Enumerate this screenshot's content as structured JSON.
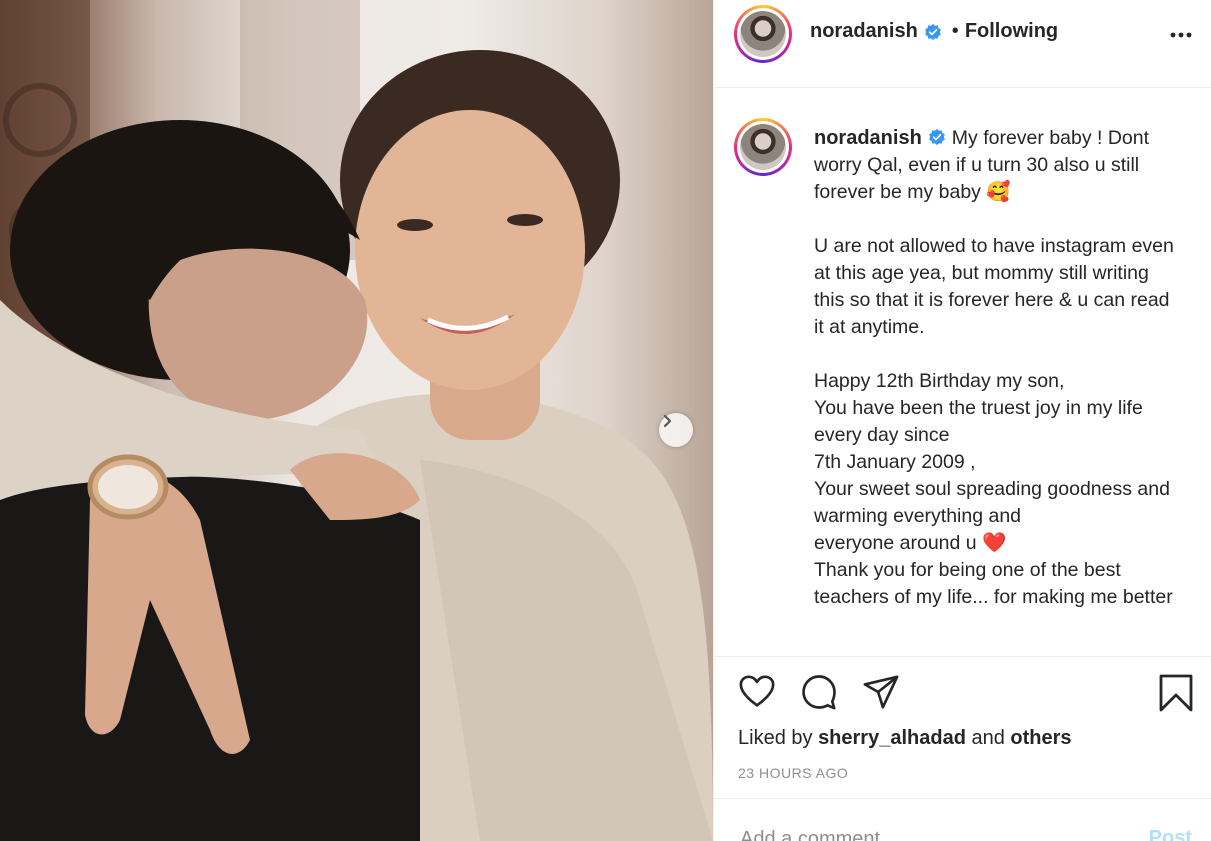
{
  "post": {
    "username": "noradanish",
    "verified": true,
    "follow_separator": "•",
    "follow_status": "Following",
    "more_icon": "more-horizontal-icon"
  },
  "caption": {
    "username": "noradanish",
    "text": "My forever baby ! Dont worry Qal, even if u turn 30 also u still forever be my baby 🥰\n\nU are not allowed to have instagram even at this age yea, but mommy still writing this so that it is forever here & u can read it at anytime.\n\nHappy 12th Birthday my son,\nYou have been the truest joy in my life every day since\n7th January 2009 ,\nYour sweet soul spreading goodness and\nwarming everything and\neveryone around u ❤️\nThank you for being one of the best teachers of my life... for making me better"
  },
  "actions": {
    "icons": [
      "heart-icon",
      "comment-icon",
      "share-icon",
      "bookmark-icon"
    ]
  },
  "likes": {
    "prefix": "Liked by",
    "user": "sherry_alhadad",
    "conjunction": "and",
    "others": "others"
  },
  "timestamp": "23 HOURS AGO",
  "comment": {
    "placeholder": "Add a comment...",
    "post_label": "Post"
  },
  "colors": {
    "verified_blue": "#3897f0",
    "post_button": "#b2dffc",
    "heart_red": "#e0112b",
    "ring_gradient": [
      "#f9ce34",
      "#ee2a7b",
      "#6228d7"
    ]
  }
}
